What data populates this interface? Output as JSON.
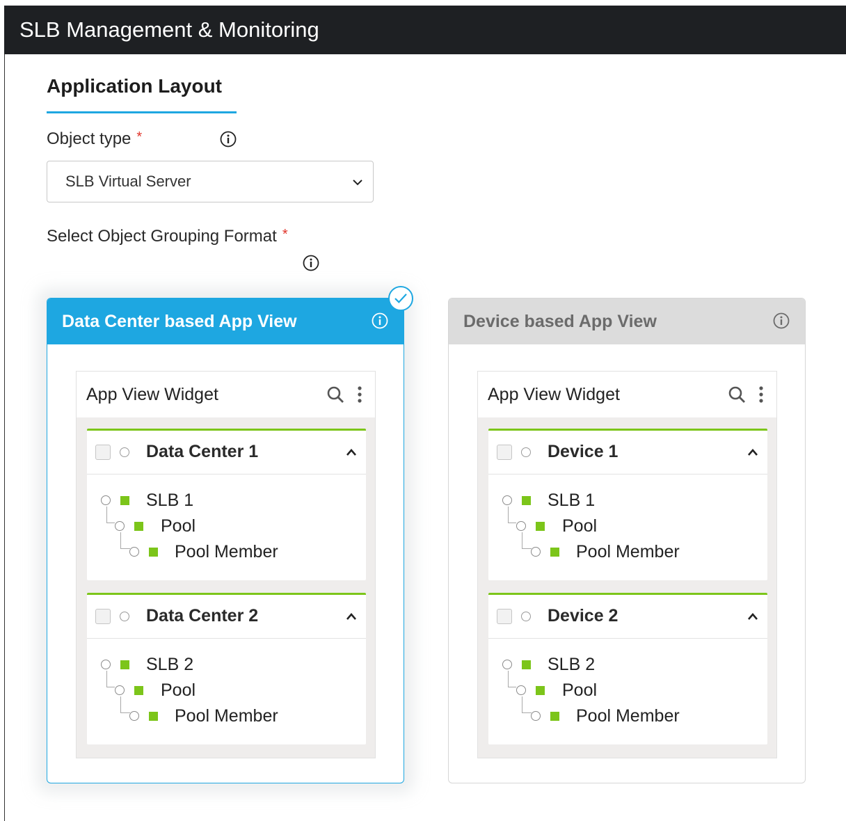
{
  "app": {
    "title": "SLB Management & Monitoring"
  },
  "section": {
    "title": "Application Layout"
  },
  "object_type": {
    "label": "Object type",
    "required_mark": "*",
    "selected": "SLB Virtual Server"
  },
  "grouping": {
    "label": "Select Object Grouping Format",
    "required_mark": "*"
  },
  "cards": [
    {
      "title": "Data Center based App View",
      "selected": true,
      "widget_title": "App View Widget",
      "groups": [
        {
          "title": "Data Center 1",
          "nodes": [
            "SLB 1",
            "Pool",
            "Pool Member"
          ]
        },
        {
          "title": "Data Center 2",
          "nodes": [
            "SLB 2",
            "Pool",
            "Pool Member"
          ]
        }
      ]
    },
    {
      "title": "Device based App View",
      "selected": false,
      "widget_title": "App View Widget",
      "groups": [
        {
          "title": "Device 1",
          "nodes": [
            "SLB 1",
            "Pool",
            "Pool Member"
          ]
        },
        {
          "title": "Device 2",
          "nodes": [
            "SLB 2",
            "Pool",
            "Pool Member"
          ]
        }
      ]
    }
  ],
  "colors": {
    "accent": "#1ea7e1",
    "status_green": "#7cc51a",
    "topbar": "#1e2023",
    "required": "#e0342a"
  }
}
